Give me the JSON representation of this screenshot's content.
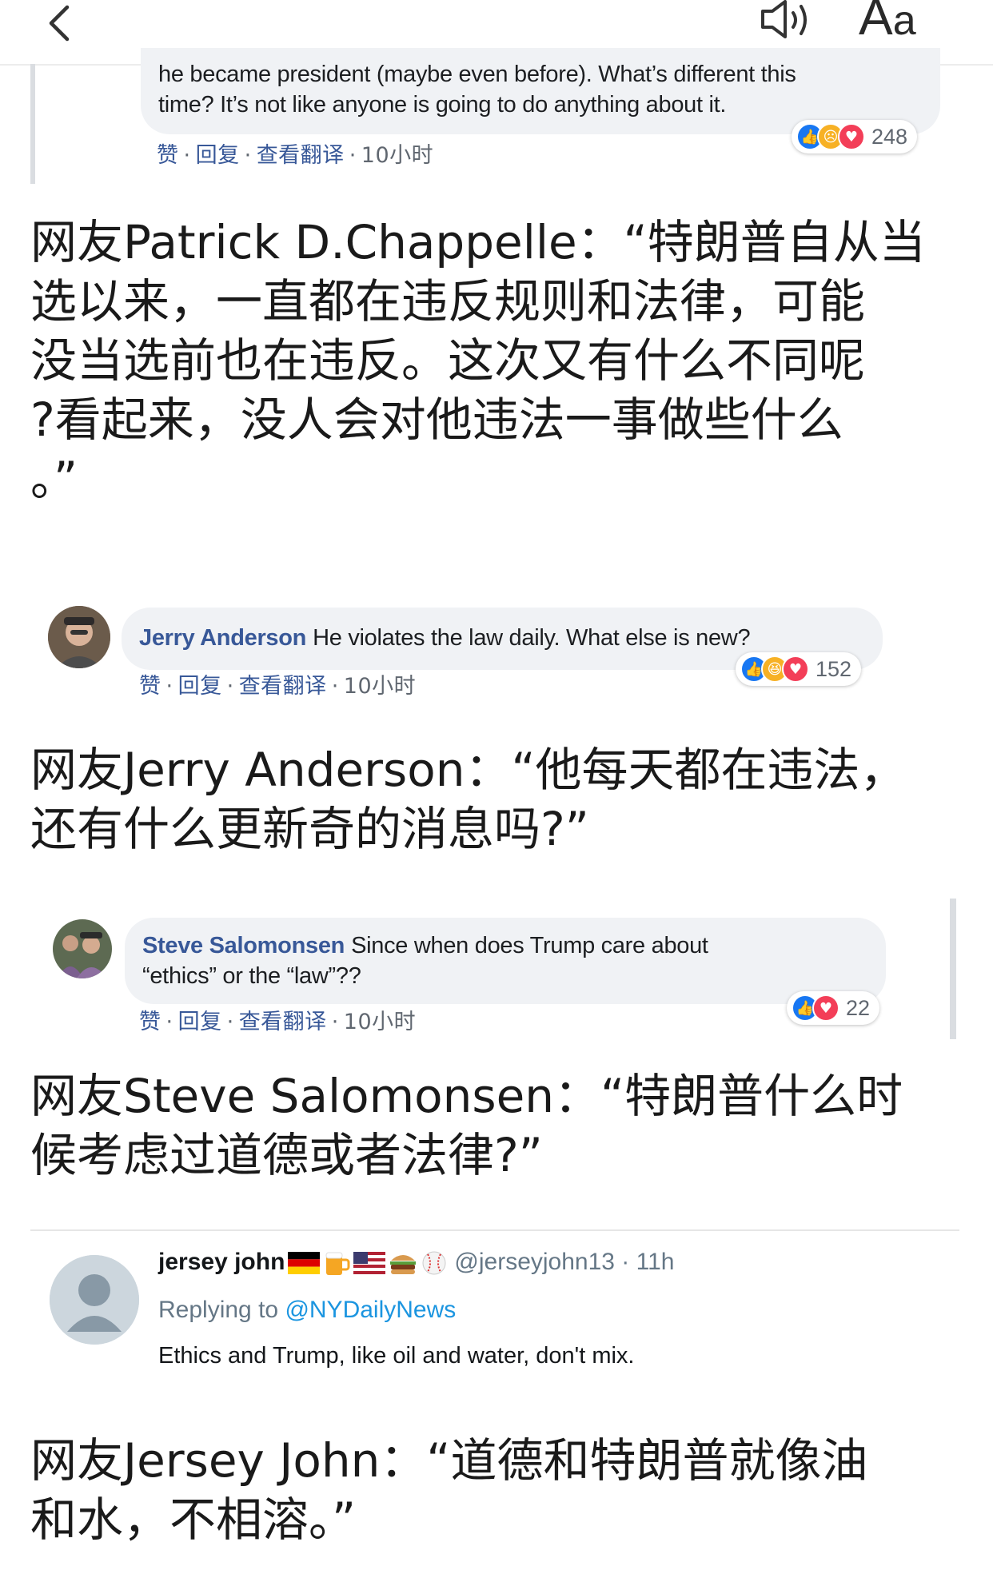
{
  "nav": {
    "back_icon": "chevron-left-icon",
    "speaker_icon": "speaker-icon",
    "font_size_big": "A",
    "font_size_small": "a"
  },
  "comments": [
    {
      "text_line1": "he became president (maybe even before). What’s different this",
      "text_line2": "time? It’s not like anyone is going to do anything about it.",
      "actions": {
        "like": "赞",
        "reply": "回复",
        "translate": "查看翻译",
        "time": "10小时"
      },
      "reactions": [
        "like",
        "sad",
        "love"
      ],
      "reaction_count": "248"
    },
    {
      "name": "Jerry Anderson",
      "text": "He violates the law daily. What else is new?",
      "actions": {
        "like": "赞",
        "reply": "回复",
        "translate": "查看翻译",
        "time": "10小时"
      },
      "reactions": [
        "like",
        "haha",
        "love"
      ],
      "reaction_count": "152"
    },
    {
      "name": "Steve Salomonsen",
      "text_line1": "Since when does Trump care about",
      "text_line2": "“ethics” or the “law”??",
      "actions": {
        "like": "赞",
        "reply": "回复",
        "translate": "查看翻译",
        "time": "10小时"
      },
      "reactions": [
        "like",
        "love"
      ],
      "reaction_count": "22"
    }
  ],
  "paragraphs": {
    "p1": "网友Patrick D.Chappelle：“特朗普自从当\n选以来，一直都在违反规则和法律，可能\n没当选前也在违反。这次又有什么不同呢\n?看起来，没人会对他违法一事做些什么\n。”",
    "p2": "网友Jerry Anderson：“他每天都在违法，\n还有什么更新奇的消息吗?”",
    "p3": "网友Steve Salomonsen：“特朗普什么时\n候考虑过道德或者法律?”",
    "p4": "网友Jersey John：“道德和特朗普就像油\n和水，不相溶。”"
  },
  "tweet": {
    "name": "jersey john",
    "name_emojis": [
      "german-flag",
      "beer-mug",
      "us-flag",
      "hamburger",
      "baseball"
    ],
    "handle_time": "@jerseyjohn13 · 11h",
    "replying_prefix": "Replying to",
    "replying_to": "@NYDailyNews",
    "text": "Ethics and Trump, like oil and water, don't mix."
  },
  "colors": {
    "fb_link": "#385898",
    "fb_bubble": "#f0f2f5",
    "like_blue": "#1877f2",
    "love_red": "#f33e58",
    "twitter_gray": "#657786",
    "twitter_blue": "#1b95e0"
  }
}
